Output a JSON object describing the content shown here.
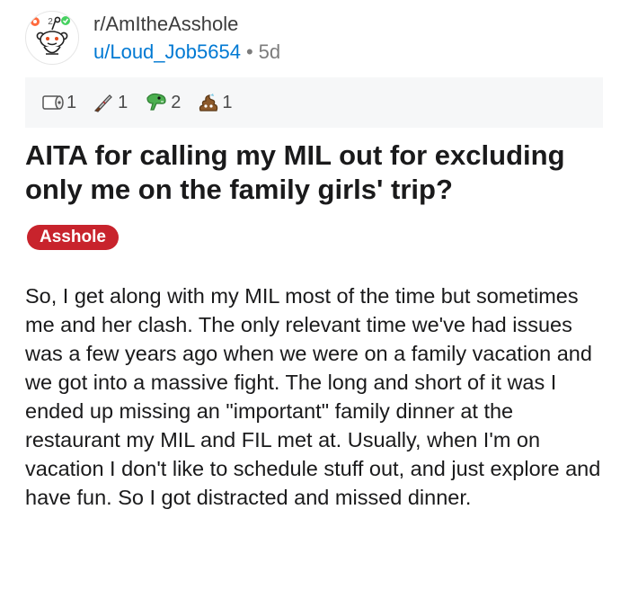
{
  "post": {
    "subreddit": "r/AmItheAsshole",
    "author": "u/Loud_Job5654",
    "separator": "•",
    "age": "5d",
    "avatar_badge": "2",
    "awards": [
      {
        "icon": "toilet-paper-icon",
        "count": "1"
      },
      {
        "icon": "knife-icon",
        "count": "1"
      },
      {
        "icon": "dinosaur-icon",
        "count": "2"
      },
      {
        "icon": "poop-icon",
        "count": "1"
      }
    ],
    "title": "AITA for calling my MIL out for excluding only me on the family girls' trip?",
    "flair": "Asshole",
    "flair_color": "#c8232c",
    "body": "So, I get along with my MIL most of the time but sometimes me and her clash. The only relevant time we've had issues was a few years ago when we were on a family vacation and we got into a massive fight. The long and short of it was I ended up missing an \"important\" family dinner at the restaurant my MIL and FIL met at. Usually, when I'm on vacation I don't like to schedule stuff out, and just explore and have fun. So I got distracted and missed dinner."
  },
  "colors": {
    "link": "#0079d3",
    "muted": "#7c7c7c",
    "awards_bg": "#f6f7f8"
  }
}
